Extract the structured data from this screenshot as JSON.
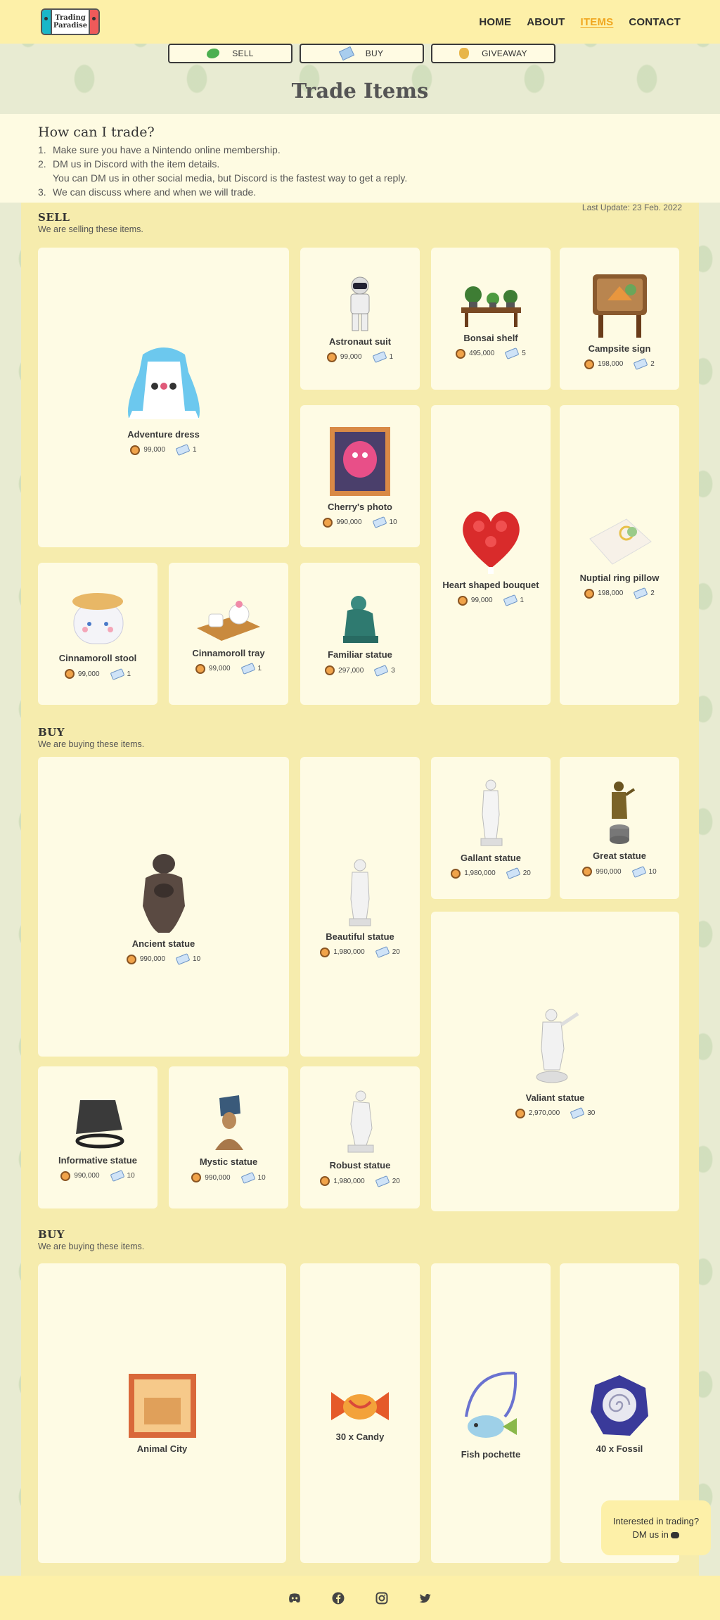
{
  "logo": {
    "line1": "Trading",
    "line2": "Paradise"
  },
  "nav": {
    "home": "HOME",
    "about": "ABOUT",
    "items": "ITEMS",
    "contact": "CONTACT"
  },
  "tabs": {
    "sell": "SELL",
    "buy": "BUY",
    "giveaway": "GIVEAWAY"
  },
  "title": "Trade Items",
  "howto": {
    "heading": "How can I trade?",
    "steps": [
      {
        "n": "1.",
        "text": "Make sure you have a Nintendo online membership."
      },
      {
        "n": "2.",
        "text": "DM us in Discord with the item details.",
        "sub": "You can DM us in other social media, but Discord is the fastest way to get a reply."
      },
      {
        "n": "3.",
        "text": "We can discuss where and when we will trade."
      }
    ]
  },
  "last_update": "Last Update: 23 Feb. 2022",
  "sell": {
    "heading": "SELL",
    "desc": "We are selling these items.",
    "items": [
      {
        "name": "Adventure dress",
        "bells": "99,000",
        "tickets": "1"
      },
      {
        "name": "Astronaut suit",
        "bells": "99,000",
        "tickets": "1"
      },
      {
        "name": "Bonsai shelf",
        "bells": "495,000",
        "tickets": "5"
      },
      {
        "name": "Campsite sign",
        "bells": "198,000",
        "tickets": "2"
      },
      {
        "name": "Cherry's photo",
        "bells": "990,000",
        "tickets": "10"
      },
      {
        "name": "Heart shaped bouquet",
        "bells": "99,000",
        "tickets": "1"
      },
      {
        "name": "Nuptial ring pillow",
        "bells": "198,000",
        "tickets": "2"
      },
      {
        "name": "Cinnamoroll stool",
        "bells": "99,000",
        "tickets": "1"
      },
      {
        "name": "Cinnamoroll tray",
        "bells": "99,000",
        "tickets": "1"
      },
      {
        "name": "Familiar statue",
        "bells": "297,000",
        "tickets": "3"
      }
    ]
  },
  "buy": {
    "heading": "BUY",
    "desc": "We are buying these items.",
    "items": [
      {
        "name": "Ancient statue",
        "bells": "990,000",
        "tickets": "10"
      },
      {
        "name": "Beautiful statue",
        "bells": "1,980,000",
        "tickets": "20"
      },
      {
        "name": "Gallant statue",
        "bells": "1,980,000",
        "tickets": "20"
      },
      {
        "name": "Great statue",
        "bells": "990,000",
        "tickets": "10"
      },
      {
        "name": "Valiant statue",
        "bells": "2,970,000",
        "tickets": "30"
      },
      {
        "name": "Informative statue",
        "bells": "990,000",
        "tickets": "10"
      },
      {
        "name": "Mystic statue",
        "bells": "990,000",
        "tickets": "10"
      },
      {
        "name": "Robust statue",
        "bells": "1,980,000",
        "tickets": "20"
      }
    ]
  },
  "giveaway": {
    "heading": "BUY",
    "desc": "We are buying these items.",
    "items": [
      {
        "name": "Animal City"
      },
      {
        "name": "30 x Candy"
      },
      {
        "name": "Fish pochette"
      },
      {
        "name": "40 x Fossil"
      }
    ]
  },
  "bubble": {
    "line1": "Interested in trading?",
    "line2": "DM us in"
  },
  "icons": [
    "discord-icon",
    "facebook-icon",
    "instagram-icon",
    "twitter-icon",
    "bell-bag-icon",
    "nook-ticket-icon"
  ],
  "colors": {
    "header_bg": "#fdf0a8",
    "accent": "#f0a61e",
    "card_bg": "#fefbe4",
    "content_bg": "#f6ecad"
  }
}
